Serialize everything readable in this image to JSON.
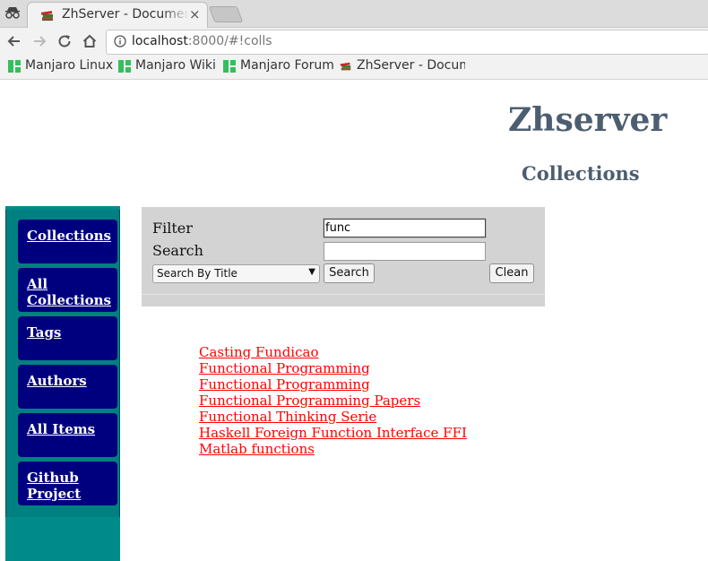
{
  "browser": {
    "tab_title": "ZhServer - Documen",
    "tab_close": "×",
    "url_host": "localhost",
    "url_rest": ":8000/#!colls",
    "bookmarks": [
      {
        "label": "Manjaro Linux",
        "icon": "manjaro-icon"
      },
      {
        "label": "Manjaro Wiki",
        "icon": "manjaro-icon"
      },
      {
        "label": "Manjaro Forum",
        "icon": "manjaro-icon"
      },
      {
        "label": "ZhServer - Docum",
        "icon": "books-icon"
      }
    ]
  },
  "page": {
    "site_title": "Zhserver",
    "heading": "Collections"
  },
  "sidebar": {
    "items": [
      {
        "line1": "Collections",
        "line2": ""
      },
      {
        "line1": "All",
        "line2": "Collections"
      },
      {
        "line1": "Tags",
        "line2": ""
      },
      {
        "line1": "Authors",
        "line2": ""
      },
      {
        "line1": "All Items",
        "line2": ""
      },
      {
        "line1": "Github",
        "line2": "Project"
      }
    ]
  },
  "filter": {
    "filter_label": "Filter",
    "filter_value": "func",
    "search_label": "Search",
    "search_value": "",
    "mode_selected": "Search By Title",
    "search_button": "Search",
    "clean_button": "Clean"
  },
  "results": [
    "Casting Fundicao",
    "Functional Programming",
    "Functional Programming",
    "Functional Programming Papers",
    "Functional Thinking Serie",
    "Haskell Foreign Function Interface FFI",
    "Matlab functions"
  ],
  "colors": {
    "sidebar_bg": "#008080",
    "nav_button_bg": "#00007f",
    "link": "#ff0000",
    "heading": "#4c5e70",
    "filter_bg": "#d3d3d3"
  }
}
